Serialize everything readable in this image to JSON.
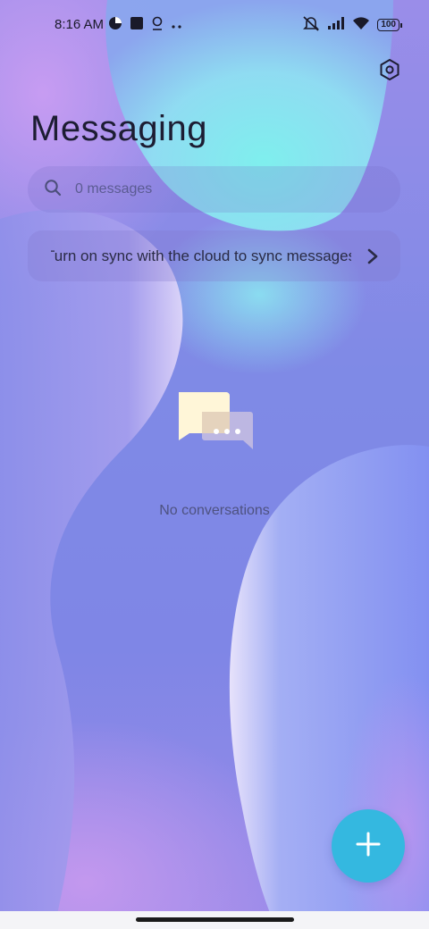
{
  "status_bar": {
    "time": "8:16 AM",
    "left_icons": [
      "data-saver-icon",
      "app-notification-icon",
      "location-icon",
      "more-dots-icon"
    ],
    "right_icons": [
      "mute-icon",
      "signal-icon",
      "wifi-icon",
      "battery-icon"
    ],
    "battery": "100"
  },
  "header": {
    "title": "Messaging",
    "settings_icon": "settings-hex-icon"
  },
  "search": {
    "placeholder": "0 messages",
    "icon": "search-icon"
  },
  "sync_banner": {
    "text": "Turn on sync with the cloud to sync messages",
    "icon": "chevron-right-icon"
  },
  "empty_state": {
    "icon": "chat-bubbles-icon",
    "text": "No conversations"
  },
  "fab": {
    "icon": "plus-icon",
    "color": "#34b8e0"
  },
  "colors": {
    "accent": "#34b8e0",
    "title": "#1d1d33"
  }
}
